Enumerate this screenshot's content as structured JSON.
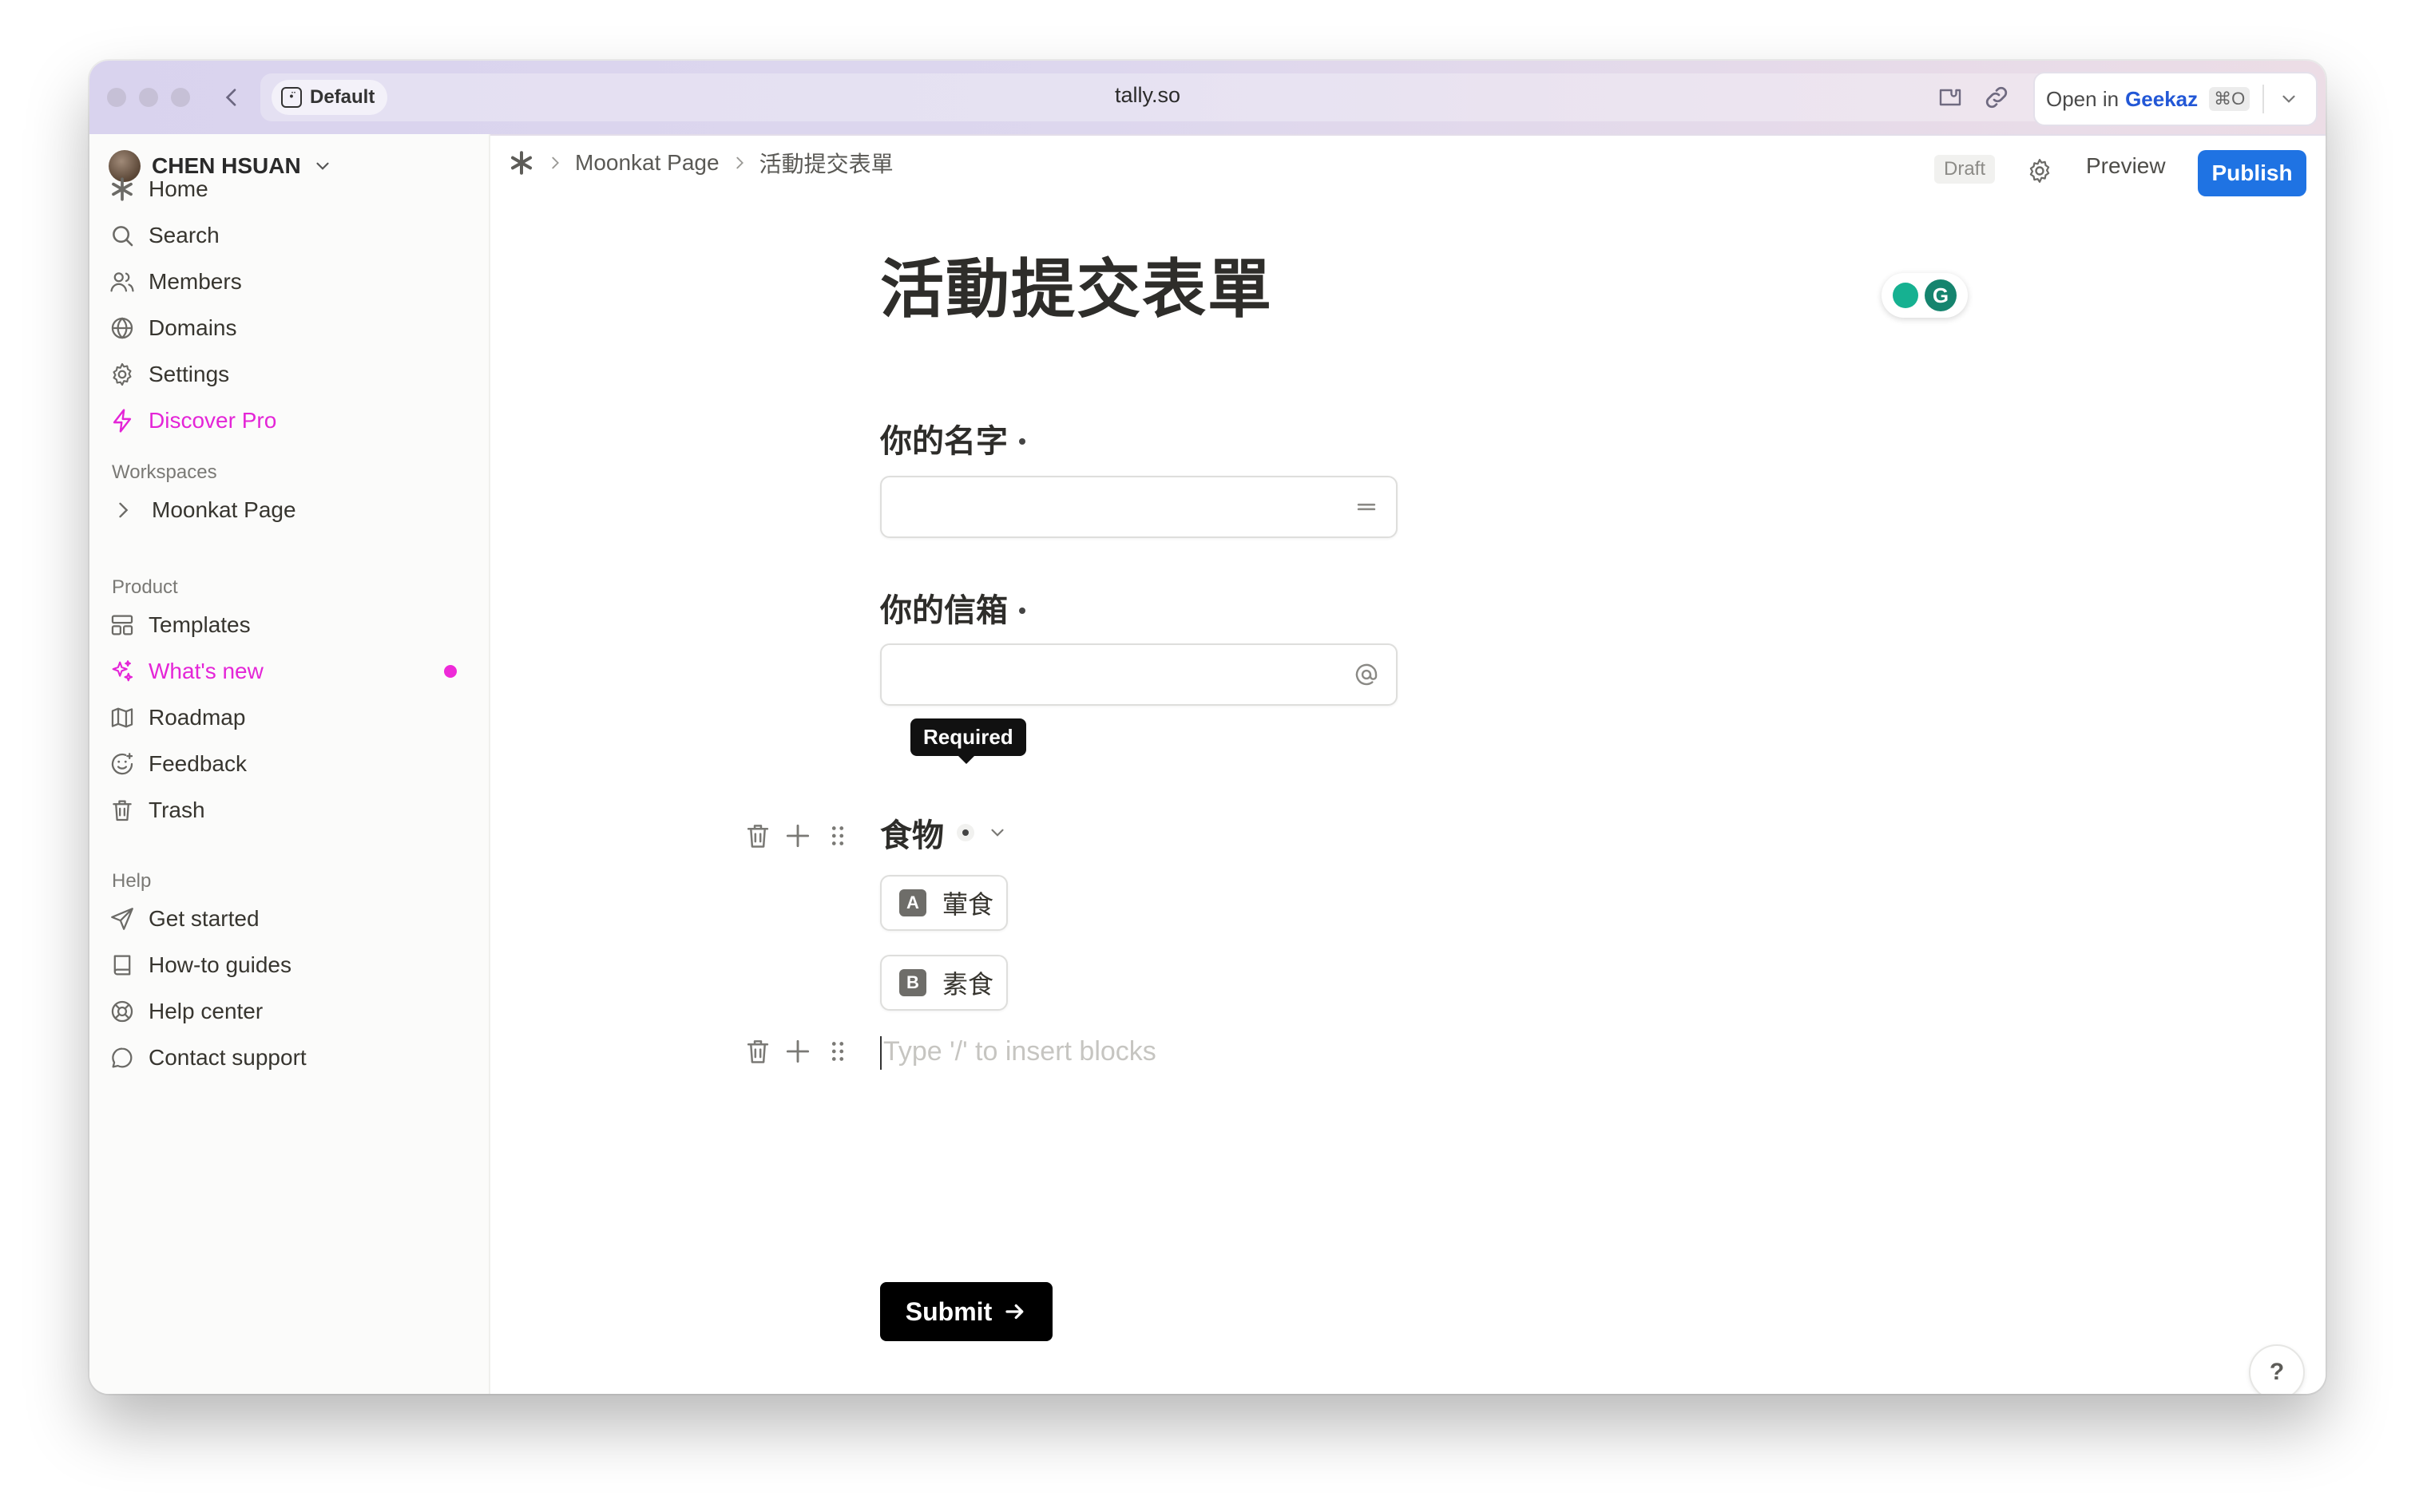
{
  "browser": {
    "profile_label": "Default",
    "url": "tally.so",
    "open_in": {
      "prefix": "Open in",
      "app": "Geekaz",
      "shortcut": "⌘O"
    }
  },
  "sidebar": {
    "user_name": "CHEN HSUAN",
    "main_items": [
      {
        "label": "Home",
        "icon": "tally-asterisk-icon"
      },
      {
        "label": "Search",
        "icon": "search-icon"
      },
      {
        "label": "Members",
        "icon": "members-icon"
      },
      {
        "label": "Domains",
        "icon": "globe-icon"
      },
      {
        "label": "Settings",
        "icon": "gear-icon"
      },
      {
        "label": "Discover Pro",
        "icon": "lightning-icon"
      }
    ],
    "workspaces_label": "Workspaces",
    "workspaces": [
      {
        "label": "Moonkat Page"
      }
    ],
    "product_label": "Product",
    "product_items": [
      {
        "label": "Templates",
        "icon": "templates-icon"
      },
      {
        "label": "What's new",
        "icon": "sparkle-icon"
      },
      {
        "label": "Roadmap",
        "icon": "map-icon"
      },
      {
        "label": "Feedback",
        "icon": "smile-icon"
      },
      {
        "label": "Trash",
        "icon": "trash-icon"
      }
    ],
    "help_label": "Help",
    "help_items": [
      {
        "label": "Get started",
        "icon": "send-icon"
      },
      {
        "label": "How-to guides",
        "icon": "book-icon"
      },
      {
        "label": "Help center",
        "icon": "lifebuoy-icon"
      },
      {
        "label": "Contact support",
        "icon": "chat-icon"
      }
    ]
  },
  "topbar": {
    "breadcrumb": [
      "Moonkat Page",
      "活動提交表單"
    ],
    "draft_label": "Draft",
    "preview_label": "Preview",
    "publish_label": "Publish"
  },
  "form": {
    "title": "活動提交表單",
    "questions": [
      {
        "label": "你的名字",
        "required": true,
        "input_icon": "short-text-icon"
      },
      {
        "label": "你的信箱",
        "required": true,
        "input_icon": "at-sign-icon"
      }
    ],
    "tooltip": "Required",
    "choice_question": {
      "label": "食物",
      "options": [
        {
          "key": "A",
          "label": "葷食"
        },
        {
          "key": "B",
          "label": "素食"
        }
      ]
    },
    "insert_placeholder": "Type '/' to insert blocks",
    "submit_label": "Submit"
  },
  "help_fab": "?",
  "colors": {
    "accent": "#1f73e3",
    "pro": "#e425d7",
    "grammarly": "#15846e"
  }
}
